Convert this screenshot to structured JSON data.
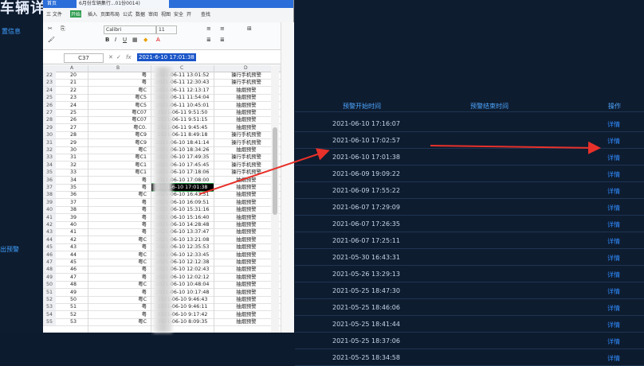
{
  "dashboard": {
    "title": "车辆详细",
    "side_labels": [
      "置信息",
      "出预警"
    ],
    "columns": {
      "start": "预警开始时间",
      "end": "预警结束时间",
      "op": "操作"
    },
    "rows": [
      {
        "time": "2021-06-10 17:16:07",
        "action": "详情"
      },
      {
        "time": "2021-06-10 17:02:57",
        "action": "详情"
      },
      {
        "time": "2021-06-10 17:01:38",
        "action": "详情"
      },
      {
        "time": "2021-06-09 19:09:22",
        "action": "详情"
      },
      {
        "time": "2021-06-09 17:55:22",
        "action": "详情"
      },
      {
        "time": "2021-06-07 17:29:09",
        "action": "详情"
      },
      {
        "time": "2021-06-07 17:26:35",
        "action": "详情"
      },
      {
        "time": "2021-06-07 17:25:11",
        "action": "详情"
      },
      {
        "time": "2021-05-30 16:43:31",
        "action": "详情"
      },
      {
        "time": "2021-05-26 13:29:13",
        "action": "详情"
      },
      {
        "time": "2021-05-25 18:47:30",
        "action": "详情"
      },
      {
        "time": "2021-05-25 18:46:06",
        "action": "详情"
      },
      {
        "time": "2021-05-25 18:41:44",
        "action": "详情"
      },
      {
        "time": "2021-05-25 18:37:06",
        "action": "详情"
      },
      {
        "time": "2021-05-25 18:34:58",
        "action": "详情"
      }
    ],
    "arrow_color": "#e8312a",
    "accent": "#2f8cff"
  },
  "spreadsheet": {
    "tabs": [
      "首页",
      "6月份车辆集行...01份0014)"
    ],
    "menu": [
      "三 文件",
      "开始",
      "插入",
      "页面布局",
      "公式",
      "数据",
      "审阅",
      "视图",
      "安全",
      "开",
      "查找"
    ],
    "font": "Calibri",
    "font_size": "11",
    "name_box": "C37",
    "formula_value": "2021-6-10 17:01:38",
    "col_headers": [
      "A",
      "B",
      "C",
      "D"
    ],
    "rows": [
      {
        "n": "22",
        "a": "20",
        "b": "粤",
        "c": "2021-06-11 13:01:52",
        "d": "操行手机预警"
      },
      {
        "n": "23",
        "a": "21",
        "b": "粤",
        "c": "2021-06-11 12:30:43",
        "d": "操行手机预警"
      },
      {
        "n": "24",
        "a": "22",
        "b": "粤C",
        "c": "2021-06-11 12:13:17",
        "d": "抽烟预警"
      },
      {
        "n": "25",
        "a": "23",
        "b": "粤C5",
        "c": "2021-06-11 11:54:04",
        "d": "抽烟预警"
      },
      {
        "n": "26",
        "a": "24",
        "b": "粤C5",
        "c": "2021-06-11 10:45:01",
        "d": "抽烟预警"
      },
      {
        "n": "27",
        "a": "25",
        "b": "粤C07",
        "c": "2021-06-11 9:51:50",
        "d": "抽烟预警"
      },
      {
        "n": "28",
        "a": "26",
        "b": "粤C07",
        "c": "2021-06-11 9:51:15",
        "d": "抽烟预警"
      },
      {
        "n": "29",
        "a": "27",
        "b": "粤C0.",
        "c": "2021-06-11 9:45:45",
        "d": "抽烟预警"
      },
      {
        "n": "30",
        "a": "28",
        "b": "粤C9",
        "c": "2021-06-11 8:49:18",
        "d": "操行手机预警"
      },
      {
        "n": "31",
        "a": "29",
        "b": "粤C9",
        "c": "2021-06-10 18:41:14",
        "d": "操行手机预警"
      },
      {
        "n": "32",
        "a": "30",
        "b": "粤C",
        "c": "2021-06-10 18:34:26",
        "d": "抽烟预警"
      },
      {
        "n": "33",
        "a": "31",
        "b": "粤C1",
        "c": "2021-06-10 17:49:35",
        "d": "操行手机预警"
      },
      {
        "n": "34",
        "a": "32",
        "b": "粤C1",
        "c": "2021-06-10 17:45:45",
        "d": "操行手机预警"
      },
      {
        "n": "35",
        "a": "33",
        "b": "粤C1",
        "c": "2021-06-10 17:18:06",
        "d": "操行手机预警"
      },
      {
        "n": "36",
        "a": "34",
        "b": "粤",
        "c": "2021-06-10 17:08:00",
        "d": "抽烟预警"
      },
      {
        "n": "37",
        "a": "35",
        "b": "粤",
        "c": "2021-6-10 17:01:38",
        "d": "抽烟预警"
      },
      {
        "n": "38",
        "a": "36",
        "b": "粤C",
        "c": "2021-06-10 16:43:51",
        "d": "抽烟预警"
      },
      {
        "n": "39",
        "a": "37",
        "b": "粤",
        "c": "2021-06-10 16:09:51",
        "d": "抽烟预警"
      },
      {
        "n": "40",
        "a": "38",
        "b": "粤",
        "c": "2021-06-10 15:31:16",
        "d": "抽烟预警"
      },
      {
        "n": "41",
        "a": "39",
        "b": "粤",
        "c": "2021-06-10 15:16:40",
        "d": "抽烟预警"
      },
      {
        "n": "42",
        "a": "40",
        "b": "粤",
        "c": "2021-06-10 14:28:48",
        "d": "抽烟预警"
      },
      {
        "n": "43",
        "a": "41",
        "b": "粤",
        "c": "2021-06-10 13:37:47",
        "d": "抽烟预警"
      },
      {
        "n": "44",
        "a": "42",
        "b": "粤C",
        "c": "2021-06-10 13:21:08",
        "d": "抽烟预警"
      },
      {
        "n": "45",
        "a": "43",
        "b": "粤",
        "c": "2021-06-10 12:35:53",
        "d": "抽烟预警"
      },
      {
        "n": "46",
        "a": "44",
        "b": "粤C",
        "c": "2021-06-10 12:33:45",
        "d": "抽烟预警"
      },
      {
        "n": "47",
        "a": "45",
        "b": "粤C",
        "c": "2021-06-10 12:12:38",
        "d": "抽烟预警"
      },
      {
        "n": "48",
        "a": "46",
        "b": "粤",
        "c": "2021-06-10 12:02:43",
        "d": "抽烟预警"
      },
      {
        "n": "49",
        "a": "47",
        "b": "粤",
        "c": "2021-06-10 12:02:12",
        "d": "抽烟预警"
      },
      {
        "n": "50",
        "a": "48",
        "b": "粤C",
        "c": "2021-06-10 10:48:04",
        "d": "抽烟预警"
      },
      {
        "n": "51",
        "a": "49",
        "b": "粤",
        "c": "2021-06-10 10:17:48",
        "d": "抽烟预警"
      },
      {
        "n": "52",
        "a": "50",
        "b": "粤C",
        "c": "2021-06-10 9:46:43",
        "d": "抽烟预警"
      },
      {
        "n": "53",
        "a": "51",
        "b": "粤",
        "c": "2021-06-10 9:46:11",
        "d": "抽烟预警"
      },
      {
        "n": "54",
        "a": "52",
        "b": "粤",
        "c": "2021-06-10 9:17:42",
        "d": "抽烟预警"
      },
      {
        "n": "55",
        "a": "53",
        "b": "粤C",
        "c": "2021-06-10 8:09:35",
        "d": "抽烟预警"
      }
    ]
  }
}
